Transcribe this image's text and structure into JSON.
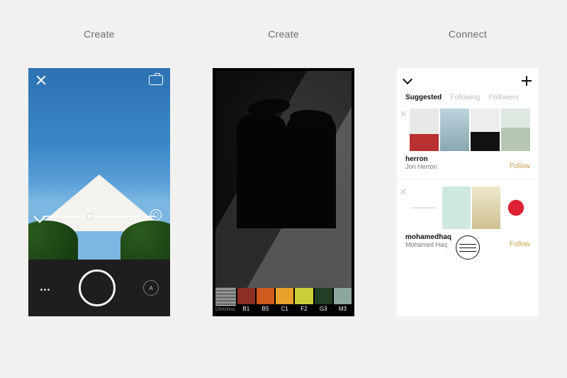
{
  "columns": {
    "camera": {
      "title": "Create"
    },
    "editor": {
      "title": "Create"
    },
    "connect": {
      "title": "Connect"
    }
  },
  "camera": {
    "exposure_value": "0.0",
    "mode_label": "A"
  },
  "editor": {
    "filters": [
      {
        "code": "ORIGINAL",
        "color": "#000000"
      },
      {
        "code": "B1",
        "color": "#8c2f24"
      },
      {
        "code": "B5",
        "color": "#d05a1e"
      },
      {
        "code": "C1",
        "color": "#e7a22c"
      },
      {
        "code": "F2",
        "color": "#c9cf3a"
      },
      {
        "code": "G3",
        "color": "#243e26"
      },
      {
        "code": "M3",
        "color": "#8fa6a0"
      }
    ]
  },
  "connect": {
    "tabs": {
      "suggested": "Suggested",
      "following": "Following",
      "followers": "Followers"
    },
    "active_tab": "suggested",
    "follow_label": "Follow",
    "users": [
      {
        "username": "herron",
        "display_name": "Jon Herron"
      },
      {
        "username": "mohamedhaq",
        "display_name": "Mohamed Haq"
      }
    ]
  }
}
